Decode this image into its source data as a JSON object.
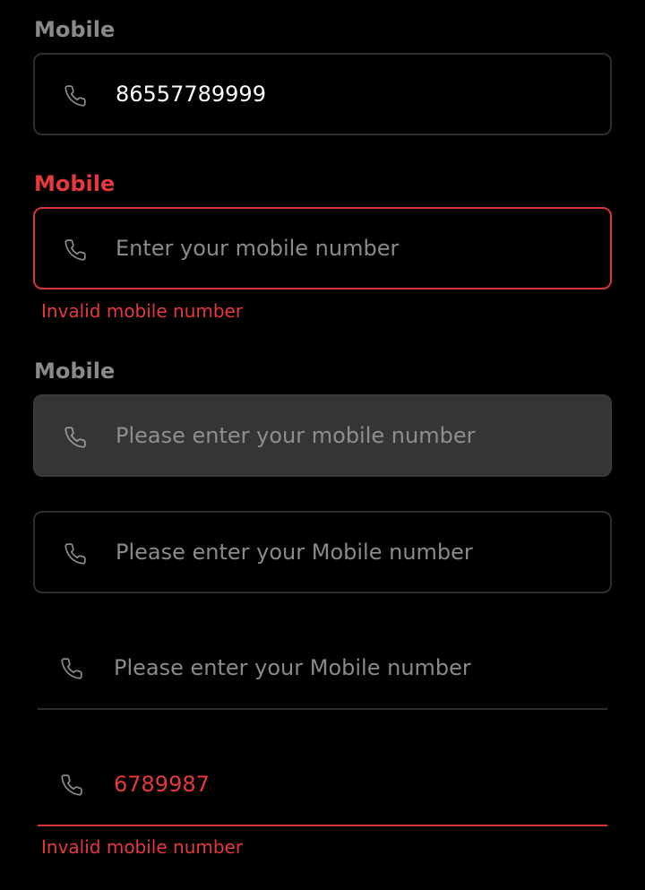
{
  "fields": [
    {
      "label": "Mobile",
      "value": "86557789999",
      "placeholder": "",
      "helper": ""
    },
    {
      "label": "Mobile",
      "value": "",
      "placeholder": "Enter your mobile number",
      "helper": "Invalid mobile number"
    },
    {
      "label": "Mobile",
      "value": "",
      "placeholder": "Please enter your mobile number",
      "helper": ""
    },
    {
      "label": "",
      "value": "",
      "placeholder": "Please enter your Mobile number",
      "helper": ""
    },
    {
      "label": "",
      "value": "",
      "placeholder": "Please enter your Mobile number",
      "helper": ""
    },
    {
      "label": "",
      "value": "6789987",
      "placeholder": "",
      "helper": "Invalid mobile number"
    }
  ],
  "icons": {
    "phone": "phone-icon"
  },
  "colors": {
    "background": "#000000",
    "label": "#8a8a8a",
    "error": "#e5393d",
    "border": "#2e2e2e",
    "disabled_fill": "#353535",
    "text": "#ffffff"
  }
}
